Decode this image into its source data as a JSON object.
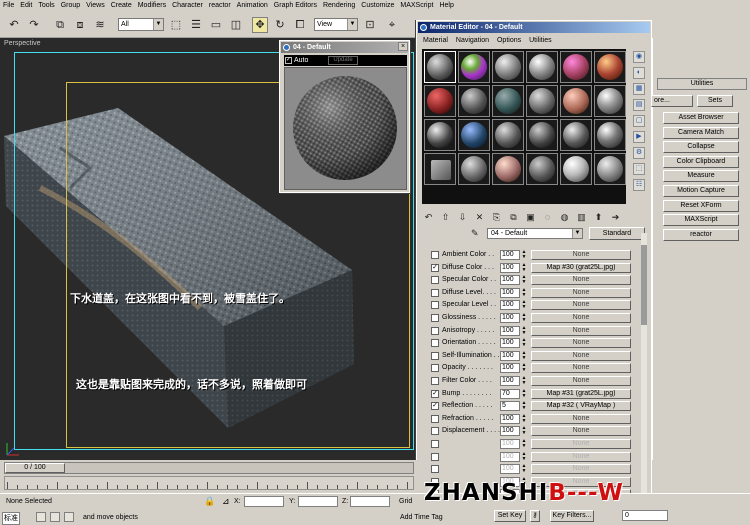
{
  "menubar": {
    "items": [
      "File",
      "Edit",
      "Tools",
      "Group",
      "Views",
      "Create",
      "Modifiers",
      "Character",
      "reactor",
      "Animation",
      "Graph Editors",
      "Rendering",
      "Customize",
      "MAXScript",
      "Help"
    ]
  },
  "toolbar": {
    "selection_filter": "All",
    "reference_coord": "View",
    "icons": [
      "undo-icon",
      "redo-icon",
      "select-link-icon",
      "unlink-icon",
      "bind-space-warp-icon",
      "select-object-icon",
      "select-by-name-icon",
      "rect-region-icon",
      "window-crossing-icon",
      "move-icon",
      "rotate-icon",
      "scale-icon"
    ]
  },
  "viewport": {
    "label": "Perspective",
    "note_1": "下水道盖，在这张图中看不到，被雪盖住了。",
    "note_2": "这也是靠贴图来完成的，话不多说，照着做即可"
  },
  "preview_window": {
    "title": "04 - Default",
    "auto_label": "Auto",
    "update_label": "Update"
  },
  "material_editor": {
    "title": "Material Editor - 04 - Default",
    "menu": [
      "Material",
      "Navigation",
      "Options",
      "Utilities"
    ],
    "material_name": "04 - Default",
    "material_type": "Standard",
    "maps": [
      {
        "enabled": false,
        "name": "Ambient Color . .",
        "amount": "100",
        "map": "None",
        "ghost": false
      },
      {
        "enabled": true,
        "name": "Diffuse Color . . .",
        "amount": "100",
        "map": "Map #30 (grat25L.jpg)",
        "ghost": false
      },
      {
        "enabled": false,
        "name": "Specular Color . .",
        "amount": "100",
        "map": "None",
        "ghost": false
      },
      {
        "enabled": false,
        "name": "Diffuse Level. . . .",
        "amount": "100",
        "map": "None",
        "ghost": false
      },
      {
        "enabled": false,
        "name": "Specular Level . .",
        "amount": "100",
        "map": "None",
        "ghost": false
      },
      {
        "enabled": false,
        "name": "Glossiness . . . . .",
        "amount": "100",
        "map": "None",
        "ghost": false
      },
      {
        "enabled": false,
        "name": "Anisotropy . . . . .",
        "amount": "100",
        "map": "None",
        "ghost": false
      },
      {
        "enabled": false,
        "name": "Orientation . . . . .",
        "amount": "100",
        "map": "None",
        "ghost": false
      },
      {
        "enabled": false,
        "name": "Self-Illumination . .",
        "amount": "100",
        "map": "None",
        "ghost": false
      },
      {
        "enabled": false,
        "name": "Opacity . . . . . . .",
        "amount": "100",
        "map": "None",
        "ghost": false
      },
      {
        "enabled": false,
        "name": "Filter Color . . . .",
        "amount": "100",
        "map": "None",
        "ghost": false
      },
      {
        "enabled": true,
        "name": "Bump . . . . . . . .",
        "amount": "70",
        "map": "Map #31 (grat25L.jpg)",
        "ghost": false
      },
      {
        "enabled": true,
        "name": "Reflection . . . . .",
        "amount": "5",
        "map": "Map #32 ( VRayMap )",
        "ghost": false
      },
      {
        "enabled": false,
        "name": "Refraction . . . . .",
        "amount": "100",
        "map": "None",
        "ghost": false
      },
      {
        "enabled": false,
        "name": "Displacement . . . .",
        "amount": "100",
        "map": "None",
        "ghost": false
      },
      {
        "enabled": false,
        "name": "",
        "amount": "100",
        "map": "None",
        "ghost": true
      },
      {
        "enabled": false,
        "name": "",
        "amount": "100",
        "map": "None",
        "ghost": true
      },
      {
        "enabled": false,
        "name": "",
        "amount": "100",
        "map": "None",
        "ghost": true
      },
      {
        "enabled": false,
        "name": "",
        "amount": "100",
        "map": "None",
        "ghost": true
      },
      {
        "enabled": false,
        "name": "",
        "amount": "100",
        "map": "None",
        "ghost": true
      }
    ]
  },
  "command_panel": {
    "rollout": "Utilities",
    "more_label": "ore...",
    "sets_label": "Sets",
    "buttons": [
      "Asset Browser",
      "Camera Match",
      "Collapse",
      "Color Clipboard",
      "Measure",
      "Motion Capture",
      "Reset XForm",
      "MAXScript",
      "reactor"
    ]
  },
  "timeline": {
    "frame": "0 / 100"
  },
  "statusbar": {
    "selection": "None Selected",
    "x_label": "X:",
    "y_label": "Y:",
    "z_label": "Z:",
    "grid_label": "Grid",
    "prompt": "Click and drag to select and move objects",
    "prompt_visible": "and move objects",
    "lang_indicator": "标准",
    "add_time_tag": "Add Time Tag",
    "set_key": "Set Key",
    "key_filters": "Key Filters...",
    "frame_field": "0"
  },
  "watermark": {
    "text_black": "ZHANSHI",
    "text_red": "B---W"
  }
}
